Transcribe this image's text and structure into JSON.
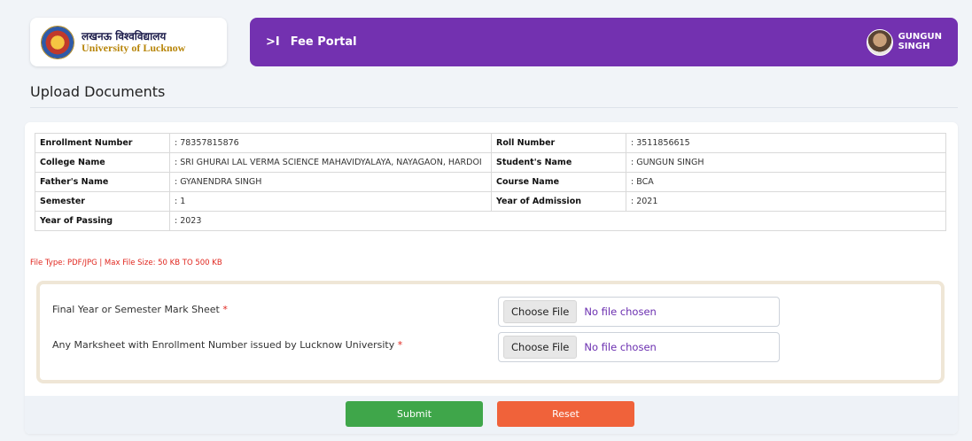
{
  "header": {
    "logo_hindi": "लखनऊ विश्वविद्यालय",
    "logo_english": "University of Lucknow",
    "collapse_icon": ">I",
    "portal_title": "Fee Portal",
    "user_first": "GUNGUN",
    "user_last": "SINGH",
    "bar_color": "#7331b0"
  },
  "page": {
    "title": "Upload Documents"
  },
  "student_info": {
    "rows": [
      [
        {
          "label": "Enrollment Number",
          "value": ": 78357815876"
        },
        {
          "label": "Roll Number",
          "value": ": 3511856615"
        }
      ],
      [
        {
          "label": "College Name",
          "value": ": SRI GHURAI LAL VERMA SCIENCE MAHAVIDYALAYA, NAYAGAON, HARDOI"
        },
        {
          "label": "Student's Name",
          "value": ": GUNGUN SINGH"
        }
      ],
      [
        {
          "label": "Father's Name",
          "value": ": GYANENDRA SINGH"
        },
        {
          "label": "Course Name",
          "value": ": BCA"
        }
      ],
      [
        {
          "label": "Semester",
          "value": ": 1"
        },
        {
          "label": "Year of Admission",
          "value": ": 2021"
        }
      ],
      [
        {
          "label": "Year of Passing",
          "value": ": 2023"
        }
      ]
    ]
  },
  "file_note": "File Type: PDF/JPG | Max File Size: 50 KB TO 500 KB",
  "uploads": [
    {
      "label": "Final Year or Semester Mark Sheet",
      "required": "*",
      "button": "Choose File",
      "status": "No file chosen"
    },
    {
      "label": "Any Marksheet with Enrollment Number issued by Lucknow University",
      "required": "*",
      "button": "Choose File",
      "status": "No file chosen"
    }
  ],
  "actions": {
    "submit": "Submit",
    "reset": "Reset",
    "submit_color": "#3fa64a",
    "reset_color": "#f0623a"
  }
}
